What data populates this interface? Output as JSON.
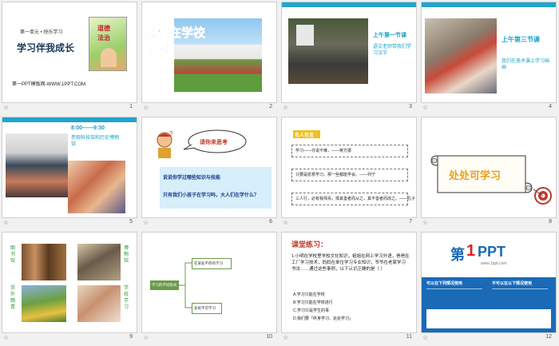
{
  "slides": [
    {
      "number": "1",
      "unit": "第一单元 • 快乐学习",
      "title": "学习伴我成长",
      "book_line1": "道德",
      "book_line2": "法治",
      "footer_text": "第一PPT模板网-WWW.1PPT.COM"
    },
    {
      "number": "2",
      "title": "我们在学校学习"
    },
    {
      "number": "3",
      "heading": "上午第一节课",
      "body": "语文老师带我们学习汉字"
    },
    {
      "number": "4",
      "heading": "上午第三节课",
      "body": "我们在美术课上学习画画"
    },
    {
      "number": "5",
      "heading": "8:00——9:30",
      "body": "参观科技馆和历史博物馆"
    },
    {
      "number": "6",
      "bubble": "请你来思考",
      "q1": "说说你学过哪些知识与技能",
      "q2": "只有我们小孩子在学习吗，大人们在学什么？"
    },
    {
      "number": "7",
      "tag": "名人名言",
      "quotes": [
        "学习——亦说不难，——蒋方振",
        "只要是愿意学习，那一些都能学会。——列宁",
        "三人行，必有我师焉；择其善者而从之，其不善者而改之。——孔子"
      ]
    },
    {
      "number": "8",
      "title": "处处可学习"
    },
    {
      "number": "9",
      "labels": [
        "图书馆",
        "博物馆",
        "郊外踏青",
        "学校学习"
      ]
    },
    {
      "number": "10",
      "root": "学习的不同形式",
      "branches": [
        "在某处不停的学习",
        "多处不可学习"
      ]
    },
    {
      "number": "11",
      "title": "课堂练习：",
      "question": "1.小明在学校里学校文化知识，姐姐在网上学习外语，爸爸在工厂学习技术，妈妈在单位学习专业知识，爷爷在老家学习书法……通过这些事例，以下认识正确的是（  ）",
      "options": [
        "A.学习只能在学校",
        "B.学习只能在学校进行",
        "C.学习只是学生的事",
        "D.我们要「终身学习、处处学习」"
      ]
    },
    {
      "number": "12",
      "logo_prefix": "第",
      "logo_number": "1",
      "logo_suffix": "PPT",
      "website": "www.1ppt.com",
      "col1": "可以在下列情况使用",
      "col2": "不可以在以下情况使用"
    }
  ]
}
